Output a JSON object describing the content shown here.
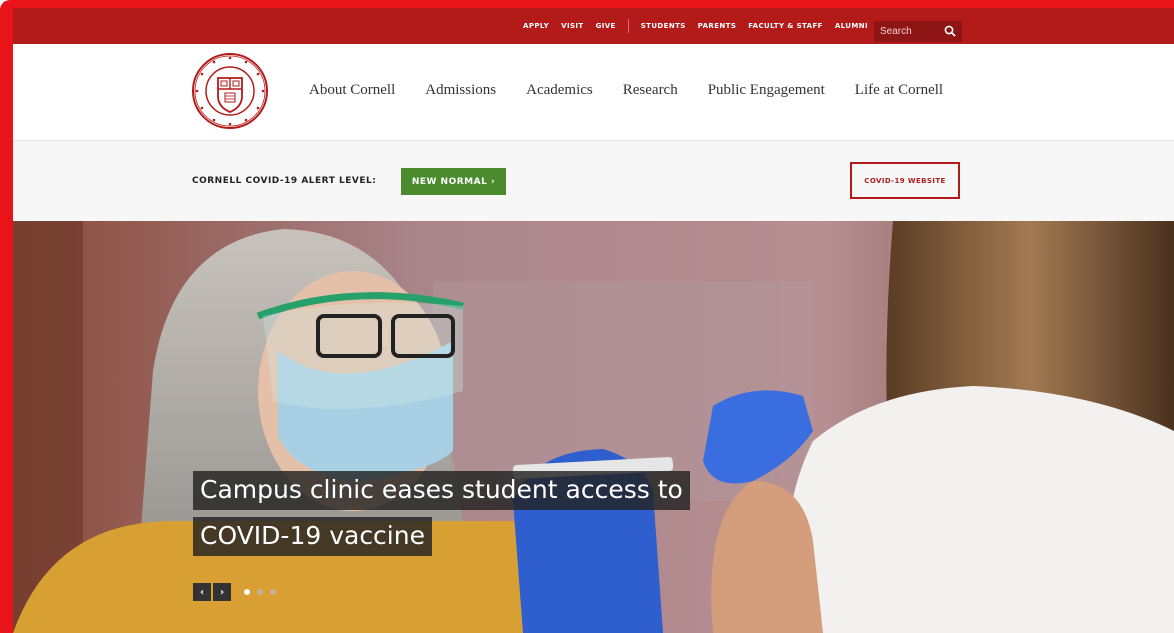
{
  "utility_nav": {
    "links": [
      "APPLY",
      "VISIT",
      "GIVE"
    ],
    "audience_links": [
      "STUDENTS",
      "PARENTS",
      "FACULTY & STAFF",
      "ALUMNI"
    ],
    "search_placeholder": "Search"
  },
  "main_nav": {
    "items": [
      "About Cornell",
      "Admissions",
      "Academics",
      "Research",
      "Public Engagement",
      "Life at Cornell"
    ]
  },
  "alert": {
    "label": "CORNELL COVID-19 ALERT LEVEL:",
    "level_button": "NEW NORMAL ›",
    "website_button": "COVID-19 WEBSITE"
  },
  "hero": {
    "caption_line1": "Campus clinic eases student access to",
    "caption_line2": "COVID-19 vaccine",
    "prev_icon": "chevron-left-icon",
    "next_icon": "chevron-right-icon",
    "slides_total": 3,
    "active_slide": 1
  },
  "colors": {
    "brand_red": "#b31b1b",
    "alert_green": "#4b8b2e",
    "frame_red": "#e8141a"
  }
}
